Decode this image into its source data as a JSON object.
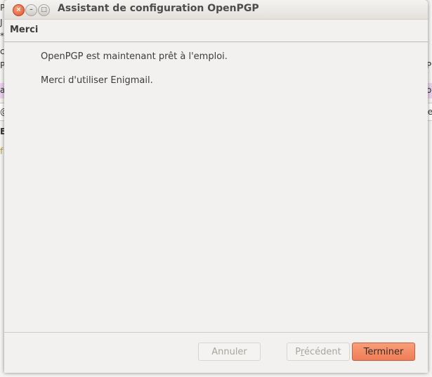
{
  "window": {
    "title": "Assistant de configuration OpenPGP",
    "buttons": {
      "close": "×",
      "minimize": "–",
      "maximize": "□"
    }
  },
  "page": {
    "title": "Merci",
    "lines": [
      "OpenPGP est maintenant prêt à l'emploi.",
      "Merci d'utiliser Enigmail."
    ]
  },
  "footer": {
    "cancel": "Annuler",
    "previous_prefix": "P",
    "previous_underlined": "r",
    "previous_rest": "écédent",
    "finish": "Terminer"
  },
  "background": {
    "left_frags": [
      "P",
      "J",
      "*",
      "c",
      "P",
      "a",
      "@",
      "E",
      "f"
    ],
    "right_frags": [
      "P",
      "o",
      "re"
    ]
  },
  "colors": {
    "accent": "#ef7c55",
    "close": "#e0512a"
  }
}
